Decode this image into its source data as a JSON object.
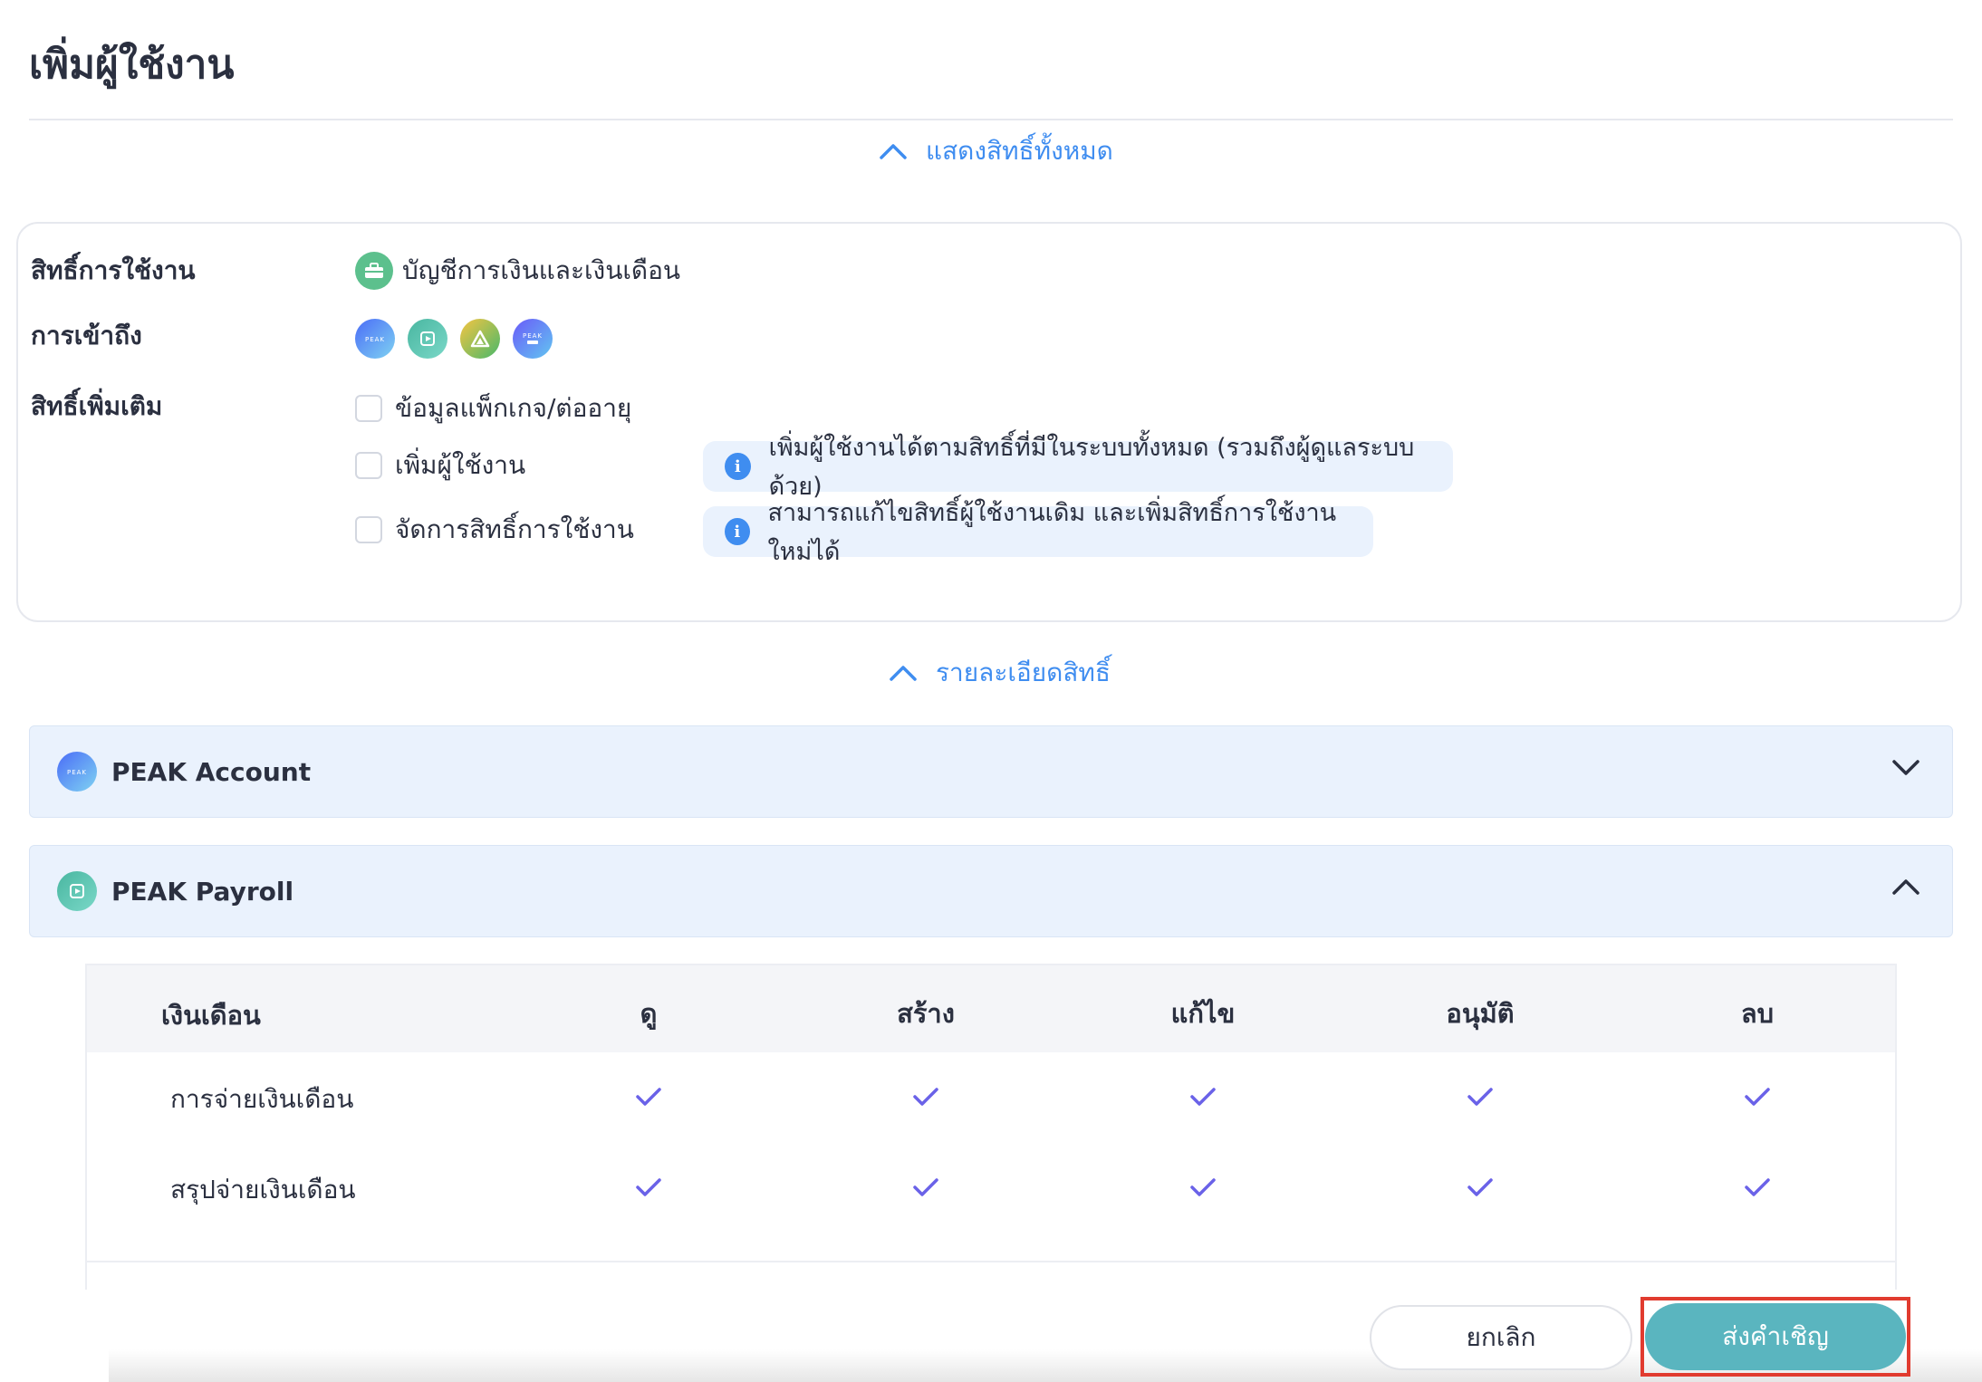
{
  "page_title": "เพิ่มผู้ใช้งาน",
  "toggle_all_label": "แสดงสิทธิ์ทั้งหมด",
  "permissions": {
    "usage_label": "สิทธิ์การใช้งาน",
    "usage_value": "บัญชีการเงินและเงินเดือน",
    "access_label": "การเข้าถึง",
    "access_apps": [
      "peak-account-icon",
      "peak-payroll-icon",
      "peak-asset-icon",
      "peak-plus-icon"
    ],
    "extra_label": "สิทธิ์เพิ่มเติม",
    "extra_options": [
      {
        "label": "ข้อมูลแพ็กเกจ/ต่ออายุ",
        "checked": false
      },
      {
        "label": "เพิ่มผู้ใช้งาน",
        "checked": false,
        "info": "เพิ่มผู้ใช้งานได้ตามสิทธิ์ที่มีในระบบทั้งหมด (รวมถึงผู้ดูแลระบบด้วย)"
      },
      {
        "label": "จัดการสิทธิ์การใช้งาน",
        "checked": false,
        "info": "สามารถแก้ไขสิทธิ์ผู้ใช้งานเดิม และเพิ่มสิทธิ์การใช้งานใหม่ได้"
      }
    ]
  },
  "toggle_detail_label": "รายละเอียดสิทธิ์",
  "accordions": [
    {
      "title": "PEAK Account",
      "logo_text": "PEAK",
      "expanded": false
    },
    {
      "title": "PEAK Payroll",
      "expanded": true
    }
  ],
  "payroll_table": {
    "headers": [
      "เงินเดือน",
      "ดู",
      "สร้าง",
      "แก้ไข",
      "อนุมัติ",
      "ลบ"
    ],
    "rows": [
      {
        "name": "การจ่ายเงินเดือน",
        "perms": [
          true,
          true,
          true,
          true,
          true
        ]
      },
      {
        "name": "สรุปจ่ายเงินเดือน",
        "perms": [
          true,
          true,
          true,
          true,
          true
        ]
      }
    ]
  },
  "buttons": {
    "cancel": "ยกเลิก",
    "send": "ส่งคำเชิญ"
  },
  "colors": {
    "accent_blue": "#3f8df0",
    "check_purple": "#6a62e8",
    "send_button": "#5ab5bf",
    "highlight_frame": "#e13b2f"
  }
}
